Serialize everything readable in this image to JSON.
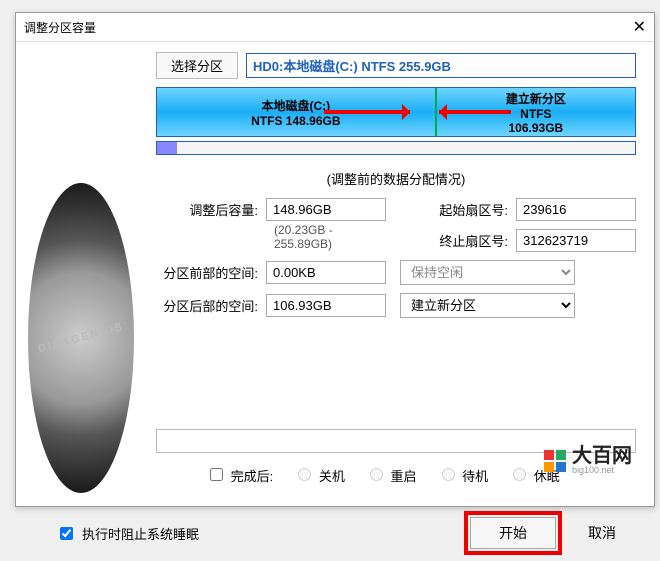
{
  "titlebar": {
    "title": "调整分区容量"
  },
  "select_partition_btn": "选择分区",
  "disk_header": "HD0:本地磁盘(C:) NTFS 255.9GB",
  "disk_graphic_label": "DISKGENIUS",
  "partitions": {
    "p1_name": "本地磁盘(C:)",
    "p1_sub": "NTFS 148.96GB",
    "p2_name": "建立新分区",
    "p2_sub": "NTFS",
    "p2_size": "106.93GB"
  },
  "section_title": "(调整前的数据分配情况)",
  "fields": {
    "adjusted_size_label": "调整后容量:",
    "adjusted_size_value": "148.96GB",
    "range_hint": "(20.23GB - 255.89GB)",
    "start_sector_label": "起始扇区号:",
    "start_sector_value": "239616",
    "end_sector_label": "终止扇区号:",
    "end_sector_value": "312623719",
    "space_before_label": "分区前部的空间:",
    "space_before_value": "0.00KB",
    "space_before_action": "保持空闲",
    "space_after_label": "分区后部的空间:",
    "space_after_value": "106.93GB",
    "space_after_action": "建立新分区"
  },
  "after_done": {
    "label": "完成后:",
    "opt1": "关机",
    "opt2": "重启",
    "opt3": "待机",
    "opt4": "休眠"
  },
  "footer": {
    "prevent_sleep": "执行时阻止系统睡眠",
    "start": "开始",
    "cancel": "取消"
  },
  "watermark": {
    "name": "大百网",
    "url": "big100.net"
  }
}
